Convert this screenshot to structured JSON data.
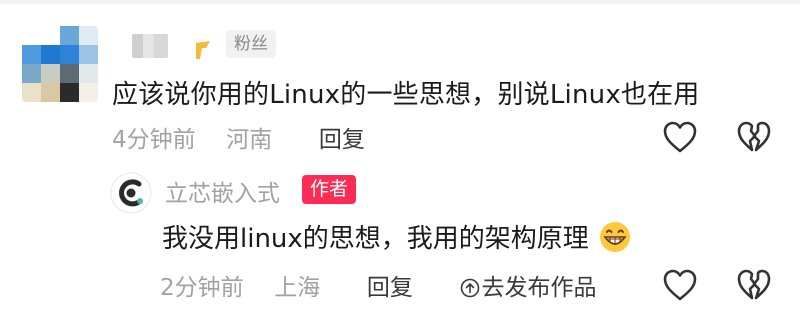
{
  "comment": {
    "user_badge": "粉丝",
    "text": "应该说你用的Linux的一些思想，别说Linux也在用",
    "time": "4分钟前",
    "location": "河南",
    "reply_label": "回复",
    "accent": "#f4b93c"
  },
  "reply": {
    "author": "立芯嵌入式",
    "author_tag": "作者",
    "text": "我没用linux的思想，我用的架构原理",
    "time": "2分钟前",
    "location": "上海",
    "reply_label": "回复",
    "go_post_label": "去发布作品",
    "tag_color": "#fe2c55"
  }
}
